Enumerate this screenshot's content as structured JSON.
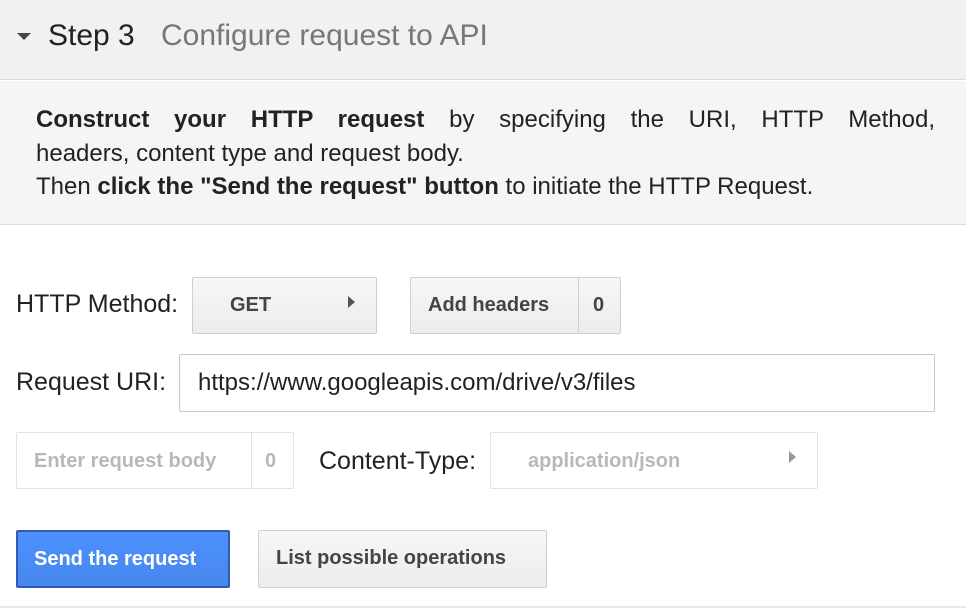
{
  "header": {
    "step_number": "Step 3",
    "step_title": "Configure request to API"
  },
  "description": {
    "line1_bold": "Construct your HTTP request",
    "line1_rest": "by specifying the URI, HTTP Method,",
    "line2": "headers, content type and request body.",
    "line3_start": "Then",
    "line3_bold": "click the \"Send the request\" button",
    "line3_rest": "to initiate the HTTP Request."
  },
  "form": {
    "method_label": "HTTP Method:",
    "method_value": "GET",
    "add_headers_label": "Add headers",
    "headers_count": "0",
    "uri_label": "Request URI:",
    "uri_value": "https://www.googleapis.com/drive/v3/files",
    "body_label": "Enter request body",
    "body_count": "0",
    "content_type_label": "Content-Type:",
    "content_type_value": "application/json"
  },
  "actions": {
    "send_label": "Send the request",
    "list_ops_label": "List possible operations"
  },
  "colors": {
    "primary": "#4d90fe",
    "header_bg": "#f1f1f1"
  },
  "icons": {
    "collapse": "caret-down-icon",
    "dropdown": "caret-right-icon"
  }
}
